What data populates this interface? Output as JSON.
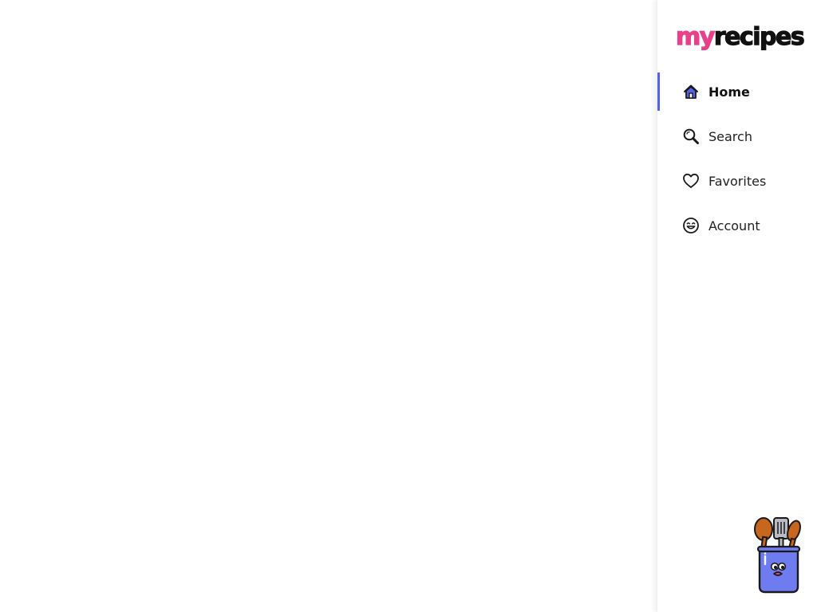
{
  "app": {
    "logo": {
      "part1": "my",
      "part2": "recipes",
      "part1_color": "#e8418b",
      "part2_color": "#111111"
    }
  },
  "sidebar": {
    "accent_color": "#5563e6",
    "items": [
      {
        "label": "Home",
        "icon": "home-icon",
        "active": true
      },
      {
        "label": "Search",
        "icon": "search-icon",
        "active": false
      },
      {
        "label": "Favorites",
        "icon": "heart-icon",
        "active": false
      },
      {
        "label": "Account",
        "icon": "smiley-icon",
        "active": false
      }
    ]
  },
  "mascot": {
    "icon": "utensil-jar-mascot-icon"
  }
}
